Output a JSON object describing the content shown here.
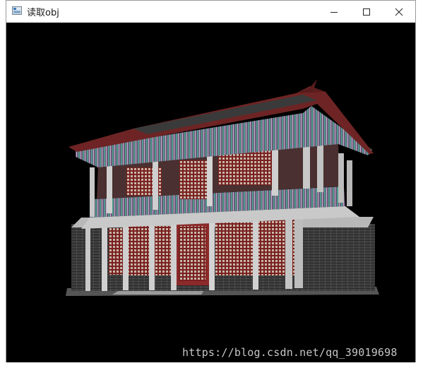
{
  "window": {
    "title": "读取obj",
    "controls": {
      "minimize": "minimize-icon",
      "maximize": "maximize-icon",
      "close": "close-icon"
    }
  },
  "viewport": {
    "content": "3D render of a two-story traditional Chinese pavilion with red lattice windows and curved eave roof",
    "background_color": "#000000"
  },
  "watermark": {
    "text": "https://blog.csdn.net/qq_39019698"
  }
}
